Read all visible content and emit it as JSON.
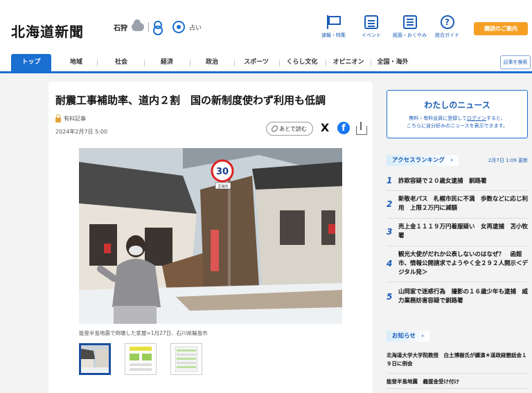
{
  "header": {
    "logo": "北海道新聞",
    "weather_location": "石狩",
    "fortune_label": "占い",
    "nav": [
      {
        "label": "速報・特集",
        "icon": "flag-icon"
      },
      {
        "label": "イベント",
        "icon": "calendar-icon"
      },
      {
        "label": "紙面・おくやみ",
        "icon": "newspaper-icon"
      },
      {
        "label": "総合ガイド",
        "icon": "help-icon"
      }
    ],
    "subscribe_label": "購読のご案内",
    "help_glyph": "?"
  },
  "navbar": {
    "items": [
      "トップ",
      "地域",
      "社会",
      "経済",
      "政治",
      "スポーツ",
      "くらし文化",
      "オピニオン",
      "全国・海外"
    ],
    "search_label": "記事を検索"
  },
  "article": {
    "title": "耐震工事補助率、道内２割　国の新制度使わず利用も低調",
    "paid_label": "有料記事",
    "date": "2024年2月7日 5:00",
    "read_later": "あとで読む",
    "x_glyph": "X",
    "fb_glyph": "f",
    "caption": "能登半島地震で倒壊した家屋=1月27日、石川県輪島市",
    "sign_speed": "30",
    "sign_zone": "区域内"
  },
  "sidebar": {
    "mynews_title": "わたしのニュース",
    "mynews_desc_before": "無料・有料会員に登録して",
    "mynews_desc_link": "ログイン",
    "mynews_desc_after": "すると、",
    "mynews_desc_line2": "こちらに自分好みのニュースを表示できます。",
    "ranking_label": "アクセスランキング　›",
    "ranking_time": "2月7日 1:09 更新",
    "ranking": [
      {
        "num": "1",
        "text": "詐欺容疑で２０歳女逮捕　釧路署"
      },
      {
        "num": "2",
        "text": "新敬老パス　札幌市民に不満　歩数などに応じ利用　上限２万円に減額"
      },
      {
        "num": "3",
        "text": "売上金１１１９万円着服疑い　女再逮捕　苫小牧署"
      },
      {
        "num": "4",
        "text": "観光大使がだれか公表しないのはなぜ？　函館市、情報公開請求でようやく全２９２人開示＜デジタル発＞"
      },
      {
        "num": "5",
        "text": "山岡家で迷惑行為　撮影の１６歳少年も逮捕　威力業務妨害容疑で釧路署"
      }
    ],
    "notice_label": "お知らせ　›",
    "notices": [
      "北海道大学大学院教授　白土博樹氏が講演＊道政経懇話会１９日に例会",
      "能登半島地震　義援金受け付け"
    ]
  }
}
